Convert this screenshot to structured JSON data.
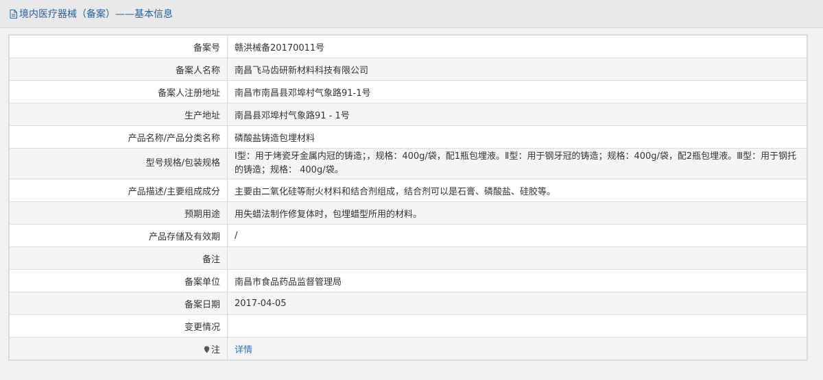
{
  "header": {
    "title": "境内医疗器械（备案）——基本信息"
  },
  "rows": [
    {
      "label": "备案号",
      "value": "赣洪械备20170011号"
    },
    {
      "label": "备案人名称",
      "value": "南昌飞马齿研新材料科技有限公司"
    },
    {
      "label": "备案人注册地址",
      "value": "南昌市南昌县邓埠村气象路91-1号"
    },
    {
      "label": "生产地址",
      "value": "南昌县邓埠村气象路91 - 1号"
    },
    {
      "label": "产品名称/产品分类名称",
      "value": "磷酸盐铸造包埋材料"
    },
    {
      "label": "型号规格/包装规格",
      "value": "Ⅰ型：用于烤瓷牙金属内冠的铸造；，规格：400g/袋，配1瓶包埋液。Ⅱ型：用于钢牙冠的铸造；规格：400g/袋，配2瓶包埋液。Ⅲ型：用于钢托的铸造；规格： 400g/袋。"
    },
    {
      "label": "产品描述/主要组成成分",
      "value": "主要由二氧化硅等耐火材料和结合剂组成，结合剂可以是石膏、磷酸盐、硅胶等。"
    },
    {
      "label": "预期用途",
      "value": "用失蜡法制作修复体时，包埋蜡型所用的材料。"
    },
    {
      "label": "产品存储及有效期",
      "value": "/"
    },
    {
      "label": "备注",
      "value": ""
    },
    {
      "label": "备案单位",
      "value": "南昌市食品药品监督管理局"
    },
    {
      "label": "备案日期",
      "value": "2017-04-05"
    },
    {
      "label": "变更情况",
      "value": ""
    },
    {
      "label": "注",
      "value": "详情"
    }
  ]
}
